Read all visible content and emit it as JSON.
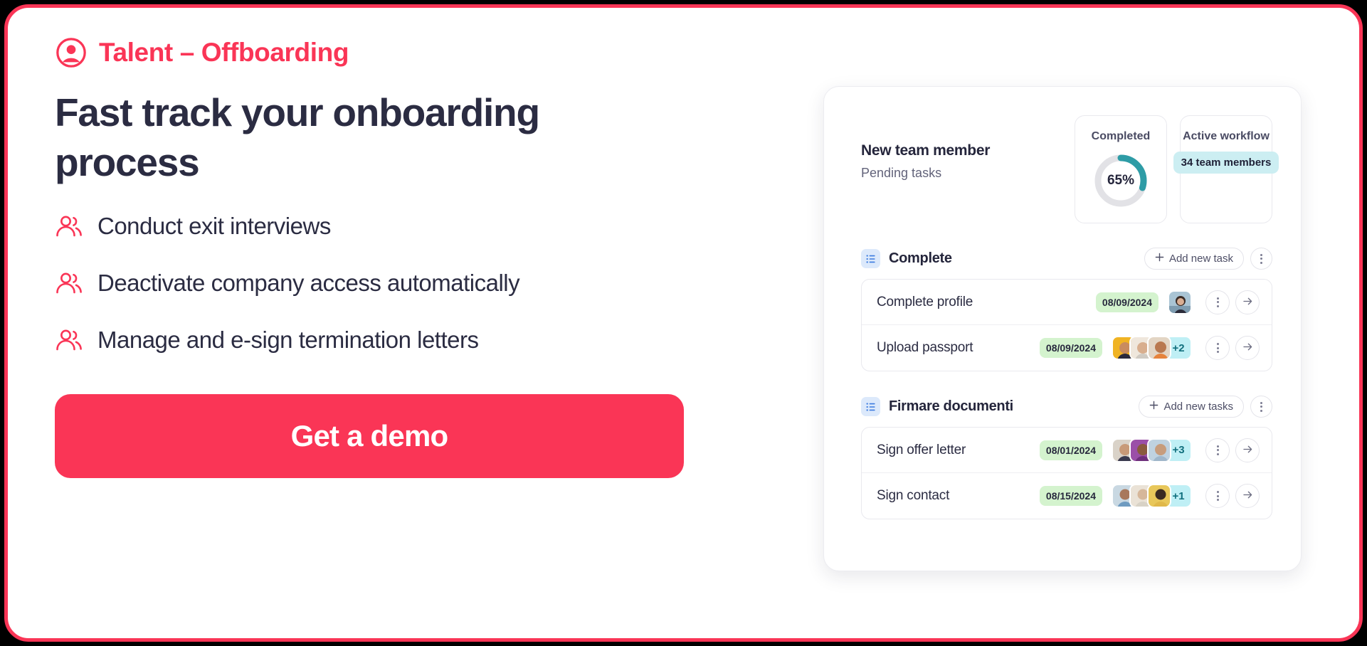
{
  "theme": {
    "accent": "#FA3556",
    "heading_color": "#2B2C42",
    "donut_color": "#2E9CA6",
    "date_pill_bg": "#D4F3CE",
    "members_pill_bg": "#CCEEF2",
    "avatar_more_bg": "#BFEFF5"
  },
  "left": {
    "eyebrow": "Talent – Offboarding",
    "eyebrow_icon": "user-circle-icon",
    "headline": "Fast track your onboarding process",
    "bullets": [
      {
        "icon": "users-icon",
        "label": "Conduct exit interviews"
      },
      {
        "icon": "users-icon",
        "label": "Deactivate company access automatically"
      },
      {
        "icon": "users-icon",
        "label": "Manage and e-sign termination letters"
      }
    ],
    "cta_label": "Get a demo"
  },
  "panel": {
    "title": "New team member",
    "subtitle": "Pending tasks",
    "stats": [
      {
        "label": "Completed",
        "type": "donut",
        "value": "65%",
        "percent": 65
      },
      {
        "label": "Active workflow",
        "type": "pill",
        "value": "34 team members"
      }
    ],
    "groups": [
      {
        "icon": "list-icon",
        "title": "Complete",
        "add_label": "Add new task",
        "menu_icon": "vertical-dots-icon",
        "tasks": [
          {
            "label": "Complete profile",
            "date": "08/09/2024",
            "avatars": [
              "avatar-photo-1"
            ],
            "extra": "",
            "menu_icon": "vertical-dots-icon",
            "action_icon": "arrow-right-icon"
          },
          {
            "label": "Upload passport",
            "date": "08/09/2024",
            "avatars": [
              "avatar-photo-2",
              "avatar-photo-3",
              "avatar-photo-4"
            ],
            "extra": "+2",
            "menu_icon": "vertical-dots-icon",
            "action_icon": "arrow-right-icon"
          }
        ]
      },
      {
        "icon": "list-icon",
        "title": "Firmare documenti",
        "add_label": "Add new tasks",
        "menu_icon": "vertical-dots-icon",
        "tasks": [
          {
            "label": "Sign offer letter",
            "date": "08/01/2024",
            "avatars": [
              "avatar-photo-5",
              "avatar-photo-6",
              "avatar-photo-7"
            ],
            "extra": "+3",
            "menu_icon": "vertical-dots-icon",
            "action_icon": "arrow-right-icon"
          },
          {
            "label": "Sign contact",
            "date": "08/15/2024",
            "avatars": [
              "avatar-photo-8",
              "avatar-photo-9",
              "avatar-photo-10"
            ],
            "extra": "+1",
            "menu_icon": "vertical-dots-icon",
            "action_icon": "arrow-right-icon"
          }
        ]
      }
    ]
  }
}
